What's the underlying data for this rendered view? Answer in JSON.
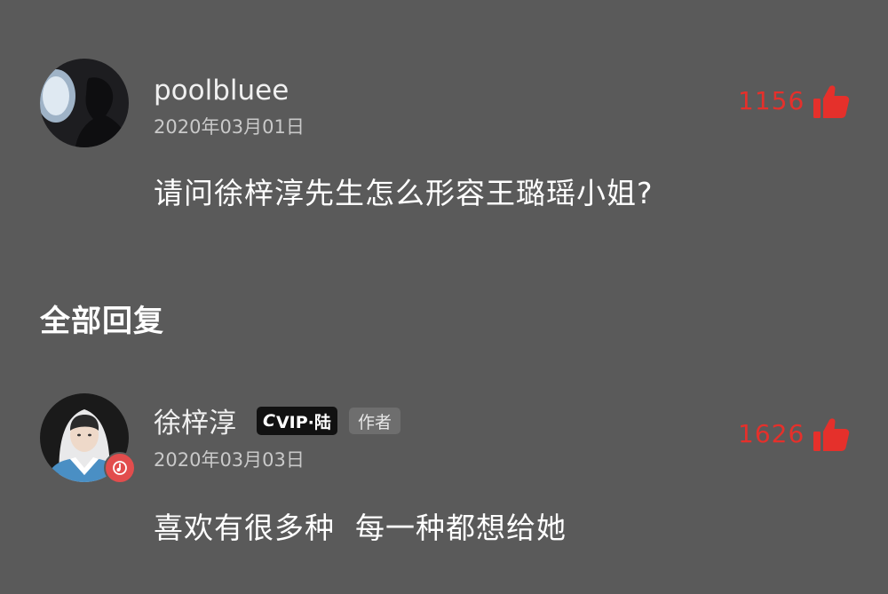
{
  "comment": {
    "username": "poolbluee",
    "date": "2020年03月01日",
    "text": "请问徐梓淳先生怎么形容王璐瑶小姐?",
    "likes": "1156"
  },
  "section_title": "全部回复",
  "reply": {
    "username": "徐梓淳",
    "vip_badge": "VIP·陆",
    "vip_prefix": "C",
    "author_badge": "作者",
    "date": "2020年03月03日",
    "text": "喜欢有很多种  每一种都想给她",
    "likes": "1626"
  },
  "colors": {
    "background": "#5a5a5a",
    "like_red": "#e5302b",
    "badge_dark": "#111111",
    "author_badge_bg": "#6e6e6e"
  },
  "icons": {
    "like": "thumbs-up-icon",
    "music": "music-note-icon"
  }
}
